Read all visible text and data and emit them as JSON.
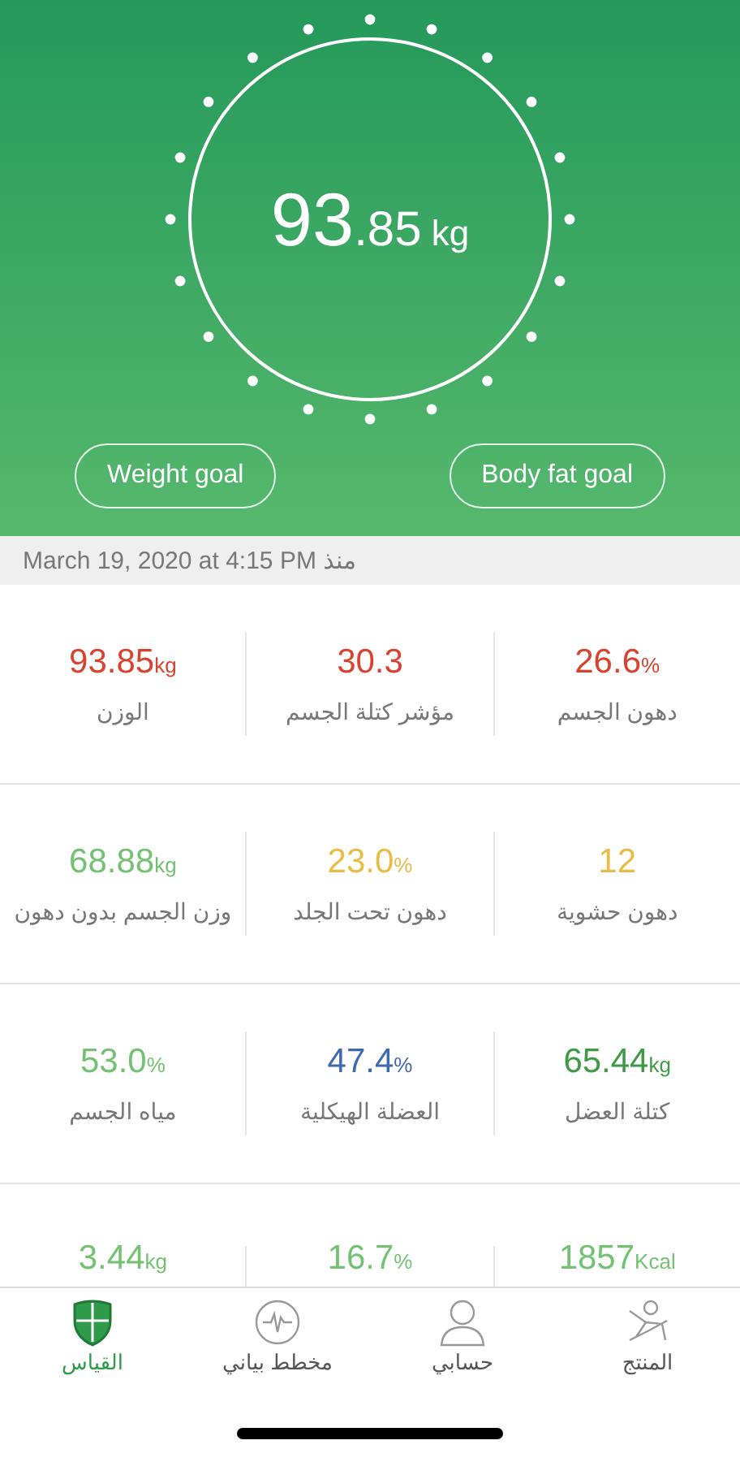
{
  "reading": {
    "integer": "93",
    "decimal": ".85",
    "unit": "kg"
  },
  "goal_buttons": [
    "Body fat goal",
    "Weight goal"
  ],
  "date": "March 19, 2020 at 4:15 PM منذ",
  "metric_rows": [
    {
      "metrics": [
        {
          "value": "26.6",
          "unit": "%",
          "label": "دهون الجسم",
          "color": "#d8432f"
        },
        {
          "value": "30.3",
          "label": "مؤشر كتلة الجسم",
          "color": "#d8432f"
        },
        {
          "value": "93.85",
          "unit": "kg",
          "label": "الوزن",
          "color": "#d8432f"
        }
      ]
    },
    {
      "metrics": [
        {
          "value": "12",
          "label": "دهون حشوية",
          "color": "#e9bb47"
        },
        {
          "value": "23.0",
          "unit": "%",
          "label": "دهون تحت الجلد",
          "color": "#e9bb47"
        },
        {
          "value": "68.88",
          "unit": "kg",
          "label": "وزن الجسم بدون دهون",
          "color": "#72c272"
        }
      ]
    },
    {
      "metrics": [
        {
          "value": "65.44",
          "unit": "kg",
          "label": "كتلة العضل",
          "color": "#3d9a45"
        },
        {
          "value": "47.4",
          "unit": "%",
          "label": "العضلة الهيكلية",
          "color": "#3f6aaf"
        },
        {
          "value": "53.0",
          "unit": "%",
          "label": "مياه الجسم",
          "color": "#72c272"
        }
      ]
    },
    {
      "metrics": [
        {
          "value": "1857",
          "unit": "Kcal",
          "color": "#72c272"
        },
        {
          "value": "16.7",
          "unit": "%",
          "color": "#72c272"
        },
        {
          "value": "3.44",
          "unit": "kg",
          "color": "#72c272"
        }
      ]
    }
  ],
  "tabs": [
    {
      "label": "المنتج",
      "kind": "figure",
      "selected": false
    },
    {
      "label": "حسابي",
      "kind": "person",
      "selected": false
    },
    {
      "label": "مخطط بياني",
      "kind": "pulse",
      "selected": false
    },
    {
      "label": "القياس",
      "kind": "shield",
      "selected": true
    }
  ]
}
